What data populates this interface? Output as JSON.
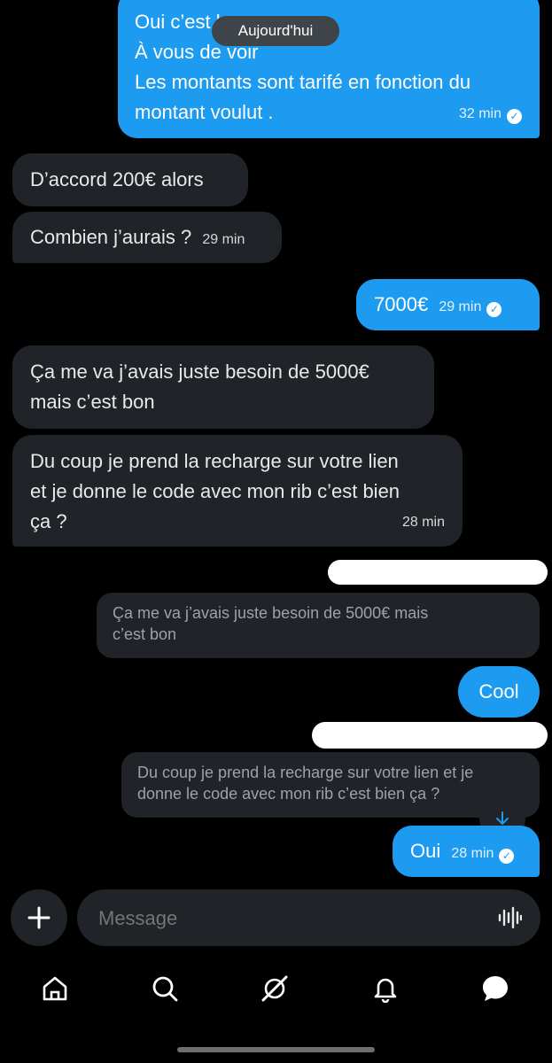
{
  "date_separator": "Aujourd'hui",
  "messages": [
    {
      "lines": [
        "Oui c’est l",
        "À vous de voir",
        "Les montants sont tarifé en fonction du",
        "montant voulut ."
      ],
      "time": "32 min"
    },
    {
      "text": "D’accord 200€ alors"
    },
    {
      "text": "Combien j’aurais ?",
      "time": "29 min"
    },
    {
      "text": "7000€",
      "time": "29 min"
    },
    {
      "lines": [
        "Ça me va j’avais juste besoin de 5000€",
        "mais c’est bon"
      ]
    },
    {
      "lines": [
        "Du coup je prend la recharge sur votre lien",
        "et je donne le code avec mon rib c’est bien",
        "ça ?"
      ],
      "time": "28 min"
    },
    {
      "quote_lines": [
        "Ça me va j’avais juste besoin de 5000€ mais",
        "c’est bon"
      ],
      "text": "Cool"
    },
    {
      "quote_lines": [
        "Du coup je prend la recharge sur votre lien et je",
        "donne le code avec mon rib c’est bien ça ?"
      ],
      "text": "Oui",
      "time": "28 min"
    }
  ],
  "composer": {
    "placeholder": "Message"
  },
  "colors": {
    "outgoing": "#1d9bf0",
    "incoming": "#202327",
    "background": "#000000"
  },
  "icons": {
    "add": "plus-icon",
    "voice": "voice-waveform-icon",
    "scroll": "arrow-down-icon",
    "nav": [
      "home-icon",
      "search-icon",
      "grok-icon",
      "bell-icon",
      "messages-icon"
    ]
  }
}
